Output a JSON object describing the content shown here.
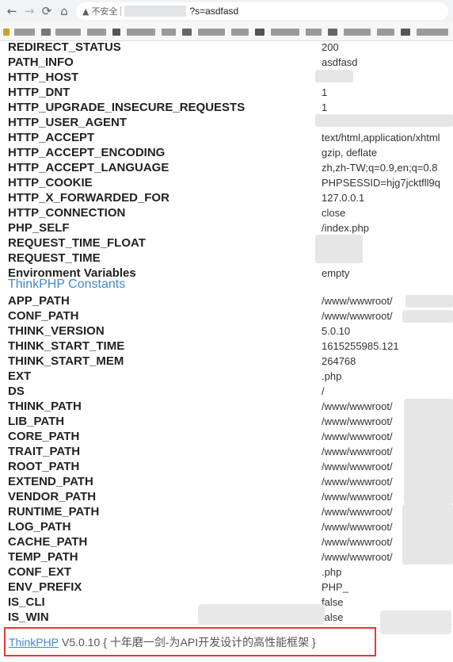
{
  "browser": {
    "back_icon": "back-arrow-icon",
    "forward_icon": "forward-arrow-icon",
    "reload_icon": "reload-icon",
    "home_icon": "home-icon",
    "insecure_label": "不安全",
    "url_query": "?s=asdfasd"
  },
  "rows_a": [
    {
      "key": "REDIRECT_STATUS",
      "value": "200"
    },
    {
      "key": "PATH_INFO",
      "value": "asdfasd"
    },
    {
      "key": "HTTP_HOST",
      "value": ""
    },
    {
      "key": "HTTP_DNT",
      "value": "1"
    },
    {
      "key": "HTTP_UPGRADE_INSECURE_REQUESTS",
      "value": "1"
    },
    {
      "key": "HTTP_USER_AGENT",
      "value": ""
    },
    {
      "key": "HTTP_ACCEPT",
      "value": "text/html,application/xhtml"
    },
    {
      "key": "HTTP_ACCEPT_ENCODING",
      "value": "gzip, deflate"
    },
    {
      "key": "HTTP_ACCEPT_LANGUAGE",
      "value": "zh,zh-TW;q=0.9,en;q=0.8"
    },
    {
      "key": "HTTP_COOKIE",
      "value": "PHPSESSID=hjg7jcktfll9q"
    },
    {
      "key": "HTTP_X_FORWARDED_FOR",
      "value": "127.0.0.1"
    },
    {
      "key": "HTTP_CONNECTION",
      "value": "close"
    },
    {
      "key": "PHP_SELF",
      "value": "/index.php"
    },
    {
      "key": "REQUEST_TIME_FLOAT",
      "value": ""
    },
    {
      "key": "REQUEST_TIME",
      "value": ""
    },
    {
      "key": "Environment Variables",
      "value": "empty"
    }
  ],
  "section_title": "ThinkPHP Constants",
  "rows_b": [
    {
      "key": "APP_PATH",
      "value": "/www/wwwroot/"
    },
    {
      "key": "CONF_PATH",
      "value": "/www/wwwroot/"
    },
    {
      "key": "THINK_VERSION",
      "value": "5.0.10"
    },
    {
      "key": "THINK_START_TIME",
      "value": "1615255985.121"
    },
    {
      "key": "THINK_START_MEM",
      "value": "264768"
    },
    {
      "key": "EXT",
      "value": ".php"
    },
    {
      "key": "DS",
      "value": "/"
    },
    {
      "key": "THINK_PATH",
      "value": "/www/wwwroot/"
    },
    {
      "key": "LIB_PATH",
      "value": "/www/wwwroot/"
    },
    {
      "key": "CORE_PATH",
      "value": "/www/wwwroot/"
    },
    {
      "key": "TRAIT_PATH",
      "value": "/www/wwwroot/"
    },
    {
      "key": "ROOT_PATH",
      "value": "/www/wwwroot/"
    },
    {
      "key": "EXTEND_PATH",
      "value": "/www/wwwroot/"
    },
    {
      "key": "VENDOR_PATH",
      "value": "/www/wwwroot/"
    },
    {
      "key": "RUNTIME_PATH",
      "value": "/www/wwwroot/"
    },
    {
      "key": "LOG_PATH",
      "value": "/www/wwwroot/"
    },
    {
      "key": "CACHE_PATH",
      "value": "/www/wwwroot/"
    },
    {
      "key": "TEMP_PATH",
      "value": "/www/wwwroot/"
    },
    {
      "key": "CONF_EXT",
      "value": ".php"
    },
    {
      "key": "ENV_PREFIX",
      "value": "PHP_"
    },
    {
      "key": "IS_CLI",
      "value": "false"
    },
    {
      "key": "IS_WIN",
      "value": "false"
    }
  ],
  "footer": {
    "link": "ThinkPHP",
    "version": "V5.0.10",
    "slogan": "{ 十年磨一剑-为API开发设计的高性能框架 }"
  },
  "colors": {
    "link_blue": "#4288ce",
    "highlight_red": "#e53935"
  }
}
